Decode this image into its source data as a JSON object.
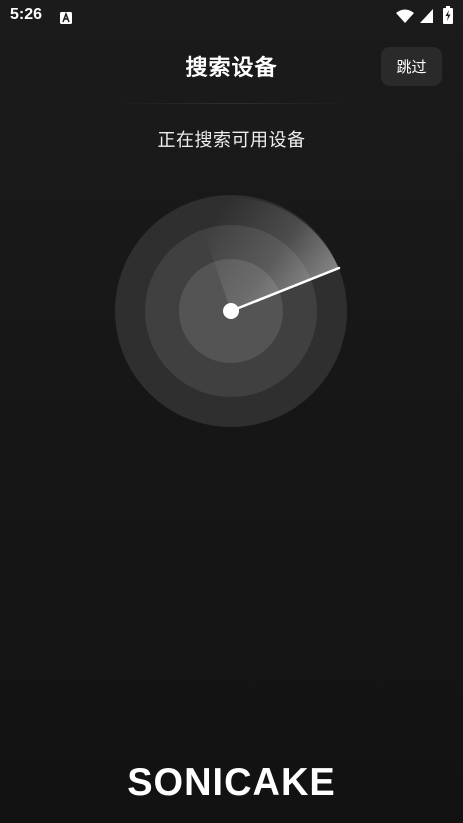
{
  "status_bar": {
    "time": "5:26"
  },
  "icons": {
    "notification": "keyboard-notification-icon",
    "wifi": "wifi-icon",
    "signal": "signal-icon",
    "battery": "battery-charging-icon"
  },
  "header": {
    "title": "搜索设备",
    "skip_label": "跳过"
  },
  "main": {
    "status_text": "正在搜索可用设备"
  },
  "brand": {
    "logo_text": "SONICAKE"
  },
  "colors": {
    "background": "#161616",
    "skip_button": "#2a2a2a",
    "radar_outer": "#2f2f2f",
    "radar_middle": "#404040",
    "radar_inner": "#545454",
    "sweep_line": "#ffffff"
  }
}
